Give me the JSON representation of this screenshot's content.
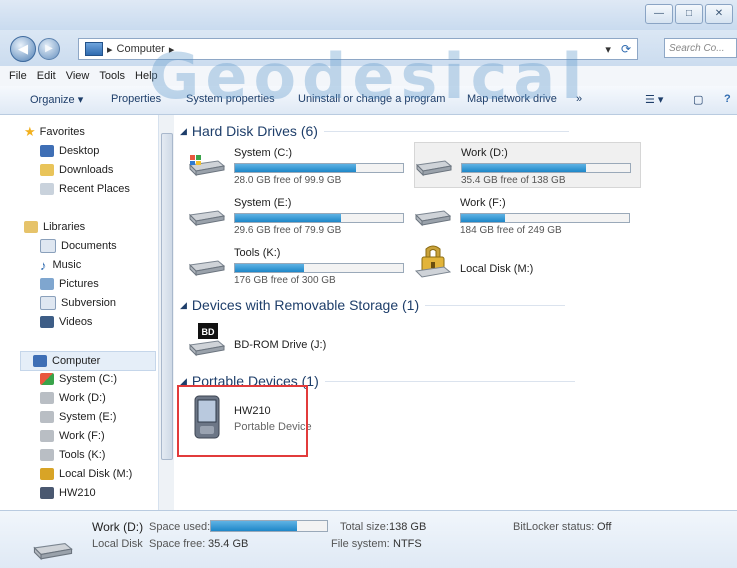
{
  "address": {
    "path": "Computer",
    "search_placeholder": "Search Co..."
  },
  "menu": [
    "File",
    "Edit",
    "View",
    "Tools",
    "Help"
  ],
  "toolbar": {
    "organize": "Organize ▾",
    "properties": "Properties",
    "system_properties": "System properties",
    "uninstall": "Uninstall or change a program",
    "map_drive": "Map network drive",
    "more": "»"
  },
  "watermark": "Geodesical",
  "sidebar": {
    "favorites": "Favorites",
    "desktop": "Desktop",
    "downloads": "Downloads",
    "recent": "Recent Places",
    "libraries": "Libraries",
    "documents": "Documents",
    "music": "Music",
    "pictures": "Pictures",
    "subversion": "Subversion",
    "videos": "Videos",
    "computer": "Computer",
    "system_c": "System (C:)",
    "work_d": "Work (D:)",
    "system_e": "System (E:)",
    "work_f": "Work (F:)",
    "tools_k": "Tools (K:)",
    "local_m": "Local Disk (M:)",
    "hw210": "HW210"
  },
  "sections": {
    "hdd": "Hard Disk Drives (6)",
    "removable": "Devices with Removable Storage (1)",
    "portable": "Portable Devices (1)"
  },
  "drives": {
    "c": {
      "name": "System (C:)",
      "free": "28.0 GB free of 99.9 GB",
      "used_fraction": 0.72
    },
    "d": {
      "name": "Work (D:)",
      "free": "35.4 GB free of 138 GB",
      "used_fraction": 0.74
    },
    "e": {
      "name": "System (E:)",
      "free": "29.6 GB free of 79.9 GB",
      "used_fraction": 0.63
    },
    "f": {
      "name": "Work (F:)",
      "free": "184 GB free of 249 GB",
      "used_fraction": 0.26
    },
    "k": {
      "name": "Tools (K:)",
      "free": "176 GB free of 300 GB",
      "used_fraction": 0.41
    },
    "m": {
      "name": "Local Disk (M:)"
    }
  },
  "bd": {
    "name": "BD-ROM Drive (J:)",
    "badge": "BD"
  },
  "portable": {
    "name": "HW210",
    "type": "Portable Device"
  },
  "details": {
    "name": "Work (D:)",
    "type": "Local Disk",
    "space_used_label": "Space used:",
    "space_used_fraction": 0.74,
    "space_free_label": "Space free:",
    "space_free": "35.4 GB",
    "total_size_label": "Total size:",
    "total_size": "138 GB",
    "fs_label": "File system:",
    "fs": "NTFS",
    "bitlocker_label": "BitLocker status:",
    "bitlocker": "Off"
  }
}
